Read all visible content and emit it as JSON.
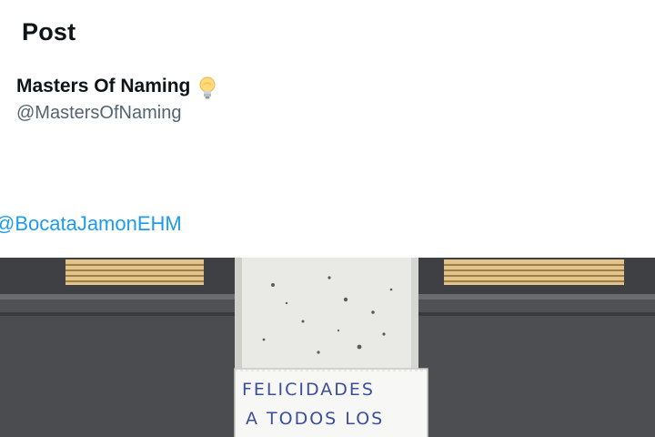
{
  "header": {
    "title": "Post"
  },
  "author": {
    "name": "Masters Of Naming",
    "handle": "@MastersOfNaming",
    "badge_icon": "lightbulb-icon"
  },
  "post": {
    "mention": "@BocataJamonEHM",
    "image": {
      "sign_lines": [
        "FELICIDADES",
        "A TODOS LOS"
      ]
    }
  },
  "colors": {
    "link": "#1d9bf0",
    "secondary_text": "#536471",
    "primary_text": "#0f1419"
  }
}
